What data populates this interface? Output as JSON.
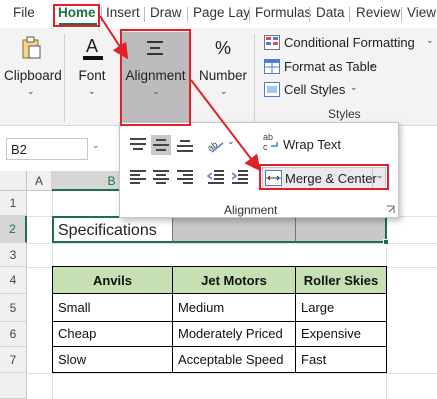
{
  "tabs": [
    "File",
    "Home",
    "Insert",
    "Draw",
    "Page Lay",
    "Formulas",
    "Data",
    "Review",
    "View"
  ],
  "ribbon": {
    "clipboard_label": "Clipboard",
    "font_label": "Font",
    "alignment_label": "Alignment",
    "number_label": "Number",
    "number_icon": "%",
    "conditional_formatting": "Conditional Formatting",
    "format_as_table": "Format as Table",
    "cell_styles": "Cell Styles",
    "styles_group": "Styles"
  },
  "name_box": "B2",
  "columns": [
    "A",
    "B"
  ],
  "rows": [
    "1",
    "2",
    "3",
    "4",
    "5",
    "6",
    "7"
  ],
  "alignment_panel": {
    "wrap_text": "Wrap Text",
    "merge_center": "Merge & Center",
    "group_label": "Alignment"
  },
  "sheet": {
    "title_cell": "Specifications",
    "headers": [
      "Anvils",
      "Jet Motors",
      "Roller Skies"
    ],
    "data": [
      [
        "Small",
        "Medium",
        "Large"
      ],
      [
        "Cheap",
        "Moderately Priced",
        "Expensive"
      ],
      [
        "Slow",
        "Acceptable Speed",
        "Fast"
      ]
    ]
  },
  "colors": {
    "highlight": "#e0212a",
    "header_fill": "#c6e0b4",
    "ribbon_bg": "#f3f3f3",
    "selected_gray": "#bcbcbc",
    "excel_green": "#1e7145"
  }
}
